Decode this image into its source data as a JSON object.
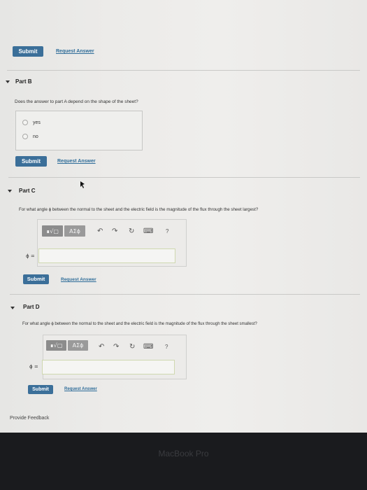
{
  "top": {
    "submit_label": "Submit",
    "request_label": "Request Answer"
  },
  "partB": {
    "title": "Part B",
    "question": "Does the answer to part A depend on the shape of the sheet?",
    "options": [
      "yes",
      "no"
    ],
    "submit_label": "Submit",
    "request_label": "Request Answer"
  },
  "partC": {
    "title": "Part C",
    "question": "For what angle ϕ between the normal to the sheet and the electric field is the magnitude of the flux through the sheet largest?",
    "toolbar": {
      "templates_label": "∎√▢",
      "symbols_label": "ΑΣϕ",
      "undo_icon": "↶",
      "redo_icon": "↷",
      "reset_icon": "↻",
      "keyboard_icon": "⌨",
      "help_label": "?"
    },
    "answer_label": "ϕ =",
    "answer_value": "",
    "submit_label": "Submit",
    "request_label": "Request Answer"
  },
  "partD": {
    "title": "Part D",
    "question": "For what angle ϕ between the normal to the sheet and the electric field is the magnitude of the flux through the sheet smallest?",
    "toolbar": {
      "templates_label": "∎√▢",
      "symbols_label": "ΑΣϕ",
      "undo_icon": "↶",
      "redo_icon": "↷",
      "reset_icon": "↻",
      "keyboard_icon": "⌨",
      "help_label": "?"
    },
    "answer_label": "ϕ =",
    "answer_value": "",
    "submit_label": "Submit",
    "request_label": "Request Answer"
  },
  "footer": {
    "feedback_label": "Provide Feedback"
  },
  "bezel": {
    "logo_text": "MacBook Pro"
  }
}
